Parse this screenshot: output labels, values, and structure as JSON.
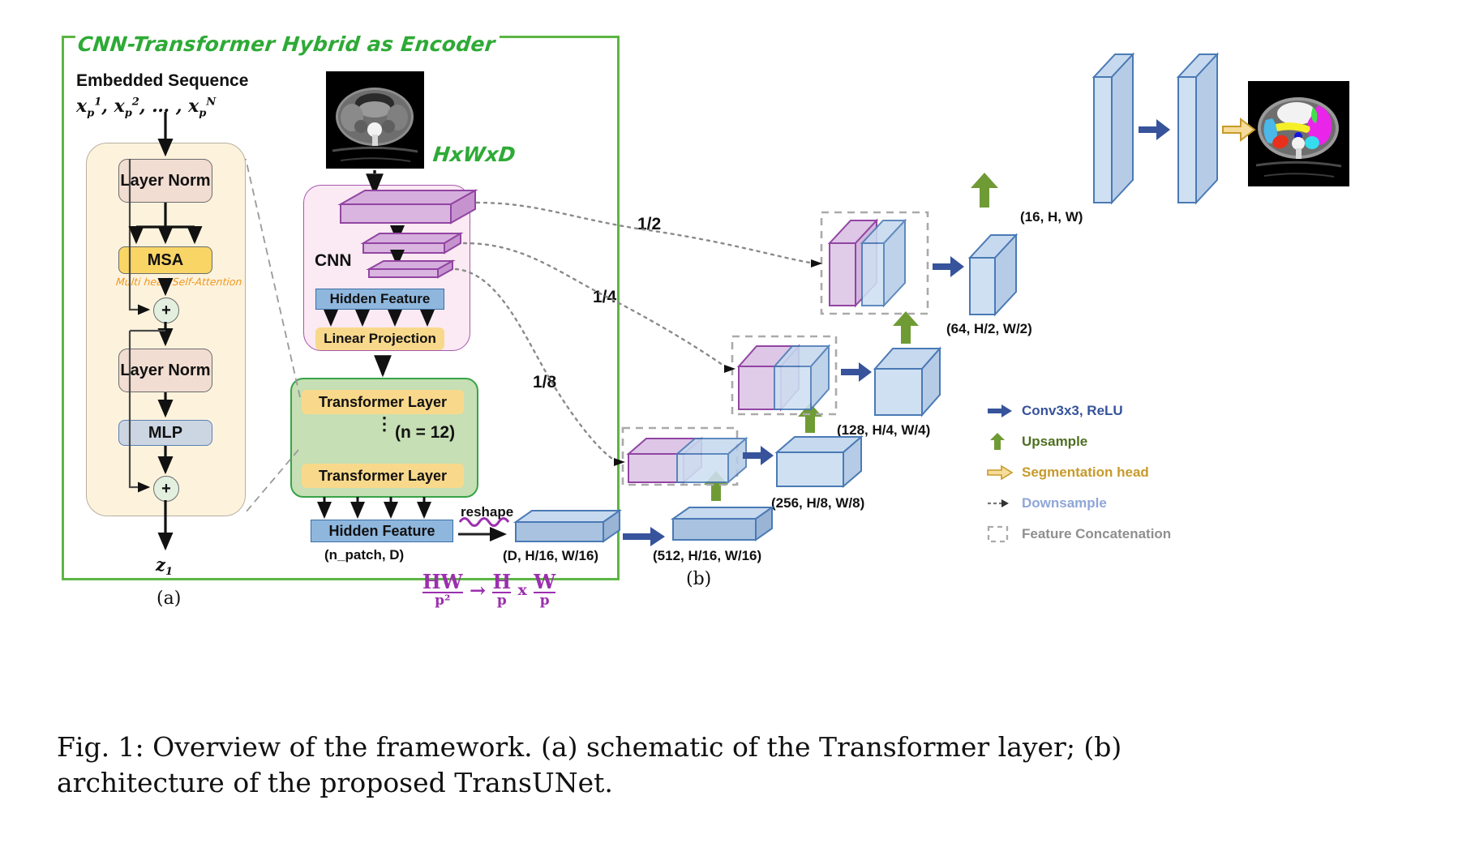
{
  "figure": {
    "caption": "Fig. 1: Overview of the framework. (a) schematic of the Transformer layer; (b) architecture of the proposed TransUNet.",
    "panel_a_label": "(a)",
    "panel_b_label": "(b)"
  },
  "encoder": {
    "title": "CNN-Transformer Hybrid as Encoder",
    "input_dims_label": "HxWxD",
    "embedded_sequence_title": "Embedded Sequence",
    "embedded_sequence_formula": "x_p^1, x_p^2, ..., x_p^N",
    "output_label": "z₁"
  },
  "transformer_layer": {
    "layer_norm_1": "Layer Norm",
    "msa": "MSA",
    "msa_annotation": "Multi head Self-Attention",
    "layer_norm_2": "Layer Norm",
    "mlp": "MLP",
    "residual_add_1": "+",
    "residual_add_2": "+"
  },
  "cnn_block": {
    "label": "CNN",
    "hidden_feature": "Hidden Feature",
    "linear_projection": "Linear Projection"
  },
  "transformer_stack": {
    "layer_top": "Transformer Layer",
    "layer_bottom": "Transformer Layer",
    "repeat_label": "(n = 12)",
    "vdots": "⋮",
    "hidden_feature": "Hidden Feature",
    "hidden_feature_shape": "(n_patch, D)",
    "reshape_label": "reshape",
    "reshape_formula": "HW/p² → H/p x W/p"
  },
  "skip_connections": {
    "half": "1/2",
    "quarter": "1/4",
    "eighth": "1/8"
  },
  "decoder_shapes": {
    "bottleneck_reshaped": "(D, H/16, W/16)",
    "stage_512": "(512, H/16, W/16)",
    "stage_256": "(256, H/8, W/8)",
    "stage_128": "(128, H/4, W/4)",
    "stage_64": "(64, H/2, W/2)",
    "stage_16": "(16, H, W)"
  },
  "legend": [
    {
      "icon": "right-arrow-solid-blue",
      "label": "Conv3x3, ReLU",
      "color": "#36539b"
    },
    {
      "icon": "up-arrow-green",
      "label": "Upsample",
      "color": "#6f9b35"
    },
    {
      "icon": "right-arrow-outline-yellow",
      "label": "Segmentation head",
      "color": "#c79a2a"
    },
    {
      "icon": "dotted-right-arrow",
      "label": "Downsample",
      "color": "#8fa6d8"
    },
    {
      "icon": "dashed-rectangle",
      "label": "Feature Concatenation",
      "color": "#8f8f8f"
    }
  ],
  "colors": {
    "encoder_frame_green": "#5cb544",
    "cnn_pink": "#fbeaf3",
    "cnn_border_purple": "#a657ad",
    "transformer_green": "#c6dfb4",
    "transformer_border": "#38a348",
    "card_cream": "#fdf3dd",
    "layernorm_peach": "#f2ddd2",
    "msa_yellow": "#f8d564",
    "mlp_blue": "#ccd6e3",
    "hidden_feature_blue": "#8fb7de",
    "linear_projection_yellow": "#f8d98b",
    "decoder_blue": "#cfe0f2",
    "decoder_purple": "#e2cdea",
    "conv_arrow_blue": "#36539b",
    "upsample_green": "#6f9b35",
    "seg_head_yellow": "#f3d27a",
    "handwriting_purple": "#9b2fae",
    "handwriting_orange": "#f0961e"
  }
}
